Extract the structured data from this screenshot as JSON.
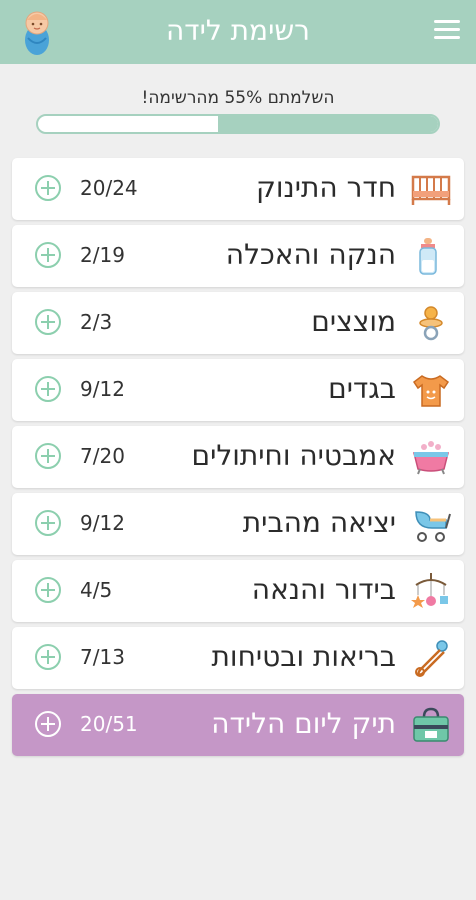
{
  "app": {
    "title": "רשימת לידה",
    "theme_color": "#a6d1bf",
    "highlight_color": "#c597c7"
  },
  "progress": {
    "text": "השלמתם 55% מהרשימה!",
    "percent": 55
  },
  "categories": [
    {
      "label": "חדר התינוק",
      "count": "20/24",
      "icon": "crib-icon"
    },
    {
      "label": "הנקה והאכלה",
      "count": "2/19",
      "icon": "baby-bottle-icon"
    },
    {
      "label": "מוצצים",
      "count": "2/3",
      "icon": "pacifier-icon"
    },
    {
      "label": "בגדים",
      "count": "9/12",
      "icon": "onesie-icon"
    },
    {
      "label": "אמבטיה וחיתולים",
      "count": "7/20",
      "icon": "bathtub-icon"
    },
    {
      "label": "יציאה מהבית",
      "count": "9/12",
      "icon": "stroller-icon"
    },
    {
      "label": "בידור והנאה",
      "count": "4/5",
      "icon": "mobile-toy-icon"
    },
    {
      "label": "בריאות ובטיחות",
      "count": "7/13",
      "icon": "safety-pin-icon"
    },
    {
      "label": "תיק ליום הלידה",
      "count": "20/51",
      "icon": "hospital-bag-icon",
      "highlighted": true
    }
  ]
}
